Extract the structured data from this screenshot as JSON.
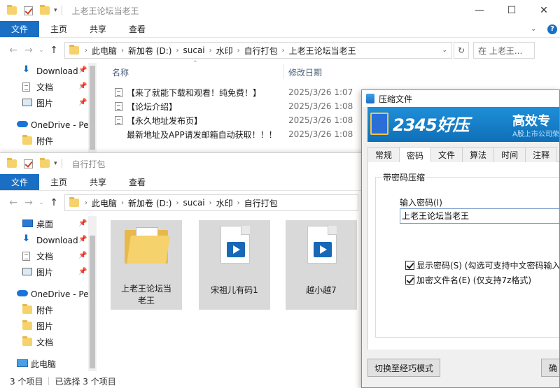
{
  "back_window": {
    "title": "上老王论坛当老王",
    "ribbon_tabs": [
      "文件",
      "主页",
      "共享",
      "查看"
    ],
    "breadcrumb": [
      "此电脑",
      "新加卷 (D:)",
      "sucai",
      "水印",
      "自行打包",
      "上老王论坛当老王"
    ],
    "search_placeholder": "在 上老王...",
    "columns": {
      "name": "名称",
      "date": "修改日期"
    },
    "files": [
      {
        "name": "【来了就能下载和观看！纯免费！】",
        "date": "2025/3/26 1:07"
      },
      {
        "name": "【论坛介绍】",
        "date": "2025/3/26 1:08"
      },
      {
        "name": "【永久地址发布页】",
        "date": "2025/3/26 1:08"
      },
      {
        "name": "最新地址及APP请发邮箱自动获取！！！",
        "date": "2025/3/26 1:08"
      }
    ],
    "nav": [
      {
        "label": "Download",
        "icon": "download-arrow-icon",
        "pinned": true
      },
      {
        "label": "文档",
        "icon": "document-icon",
        "pinned": true
      },
      {
        "label": "图片",
        "icon": "picture-icon",
        "pinned": true
      },
      {
        "label": "OneDrive - Per",
        "icon": "onedrive-cloud-icon",
        "pinned": false
      },
      {
        "label": "附件",
        "icon": "folder-icon",
        "pinned": false
      }
    ]
  },
  "front_window": {
    "title": "自行打包",
    "ribbon_tabs": [
      "文件",
      "主页",
      "共享",
      "查看"
    ],
    "breadcrumb": [
      "此电脑",
      "新加卷 (D:)",
      "sucai",
      "水印",
      "自行打包"
    ],
    "nav": [
      {
        "label": "桌面",
        "icon": "desktop-icon",
        "pinned": true
      },
      {
        "label": "Download",
        "icon": "download-arrow-icon",
        "pinned": true
      },
      {
        "label": "文档",
        "icon": "document-icon",
        "pinned": true
      },
      {
        "label": "图片",
        "icon": "picture-icon",
        "pinned": true
      },
      {
        "label": "OneDrive - Per",
        "icon": "onedrive-cloud-icon",
        "pinned": false
      },
      {
        "label": "附件",
        "icon": "folder-icon",
        "pinned": false
      },
      {
        "label": "图片",
        "icon": "folder-icon",
        "pinned": false
      },
      {
        "label": "文档",
        "icon": "folder-icon",
        "pinned": false
      },
      {
        "label": "此电脑",
        "icon": "computer-icon",
        "pinned": false
      }
    ],
    "items": [
      {
        "label": "上老王论坛当老王",
        "type": "folder"
      },
      {
        "label": "宋祖儿有码1",
        "type": "video"
      },
      {
        "label": "越小越7",
        "type": "video"
      }
    ],
    "status": {
      "count": "3 个项目",
      "selected": "已选择 3 个项目"
    }
  },
  "dialog": {
    "title": "压缩文件",
    "banner": {
      "logo": "2345好压",
      "slogan": "高效专",
      "sub": "A股上市公司荣"
    },
    "tabs": [
      "常规",
      "密码",
      "文件",
      "算法",
      "时间",
      "注释"
    ],
    "active_tab": "密码",
    "group_title": "带密码压缩",
    "password_label": "输入密码(I)",
    "password_value": "上老王论坛当老王",
    "show_password": "显示密码(S) (勾选可支持中文密码输入)",
    "encrypt_names": "加密文件名(E) (仅支持7z格式)",
    "switch_button": "切换至经巧模式",
    "ok_button": "确"
  }
}
